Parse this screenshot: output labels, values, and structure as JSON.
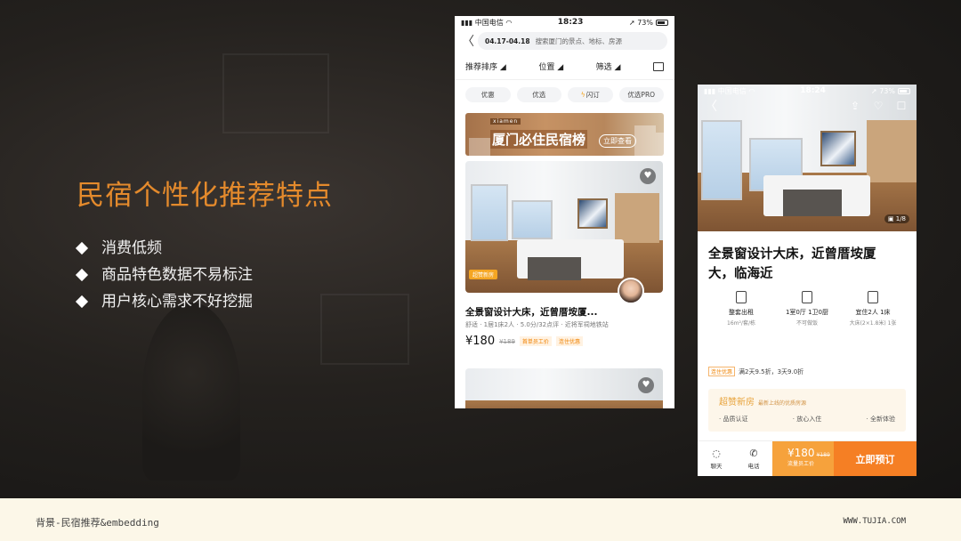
{
  "slide": {
    "title": "民宿个性化推荐特点",
    "bullets": [
      "消费低频",
      "商品特色数据不易标注",
      "用户核心需求不好挖掘"
    ],
    "footer_left": "背景-民宿推荐&embedding",
    "footer_right": "WWW.TUJIA.COM"
  },
  "colors": {
    "accent": "#e48a2c",
    "orange": "#f57f24",
    "footer_bg": "#fcf7e8"
  },
  "phone1": {
    "status": {
      "carrier": "中国电信",
      "time": "18:23",
      "battery": "73%"
    },
    "search": {
      "dates": "04.17-04.18",
      "placeholder": "搜索厦门的景点、地标、房源"
    },
    "filters": [
      "推荐排序",
      "位置",
      "筛选"
    ],
    "chips": [
      "优惠",
      "优选",
      "闪订",
      "优选PRO"
    ],
    "banner": {
      "tag": "xiamen",
      "title": "厦门必住民宿榜",
      "cta": "立即查看"
    },
    "listing": {
      "tag": "超赞新房",
      "title": "全景窗设计大床，近曾厝垵厦...",
      "meta": "舒适 · 1居1床2人 · 5.0分/32点评 · 近将军祠地铁站",
      "price": "¥180",
      "old_price": "¥189",
      "tags": [
        "首单员工价",
        "连住优惠"
      ]
    }
  },
  "phone2": {
    "status": {
      "carrier": "中国电信",
      "time": "18:24",
      "battery": "73%"
    },
    "photo_counter": "1/8",
    "title": "全景窗设计大床，近曾厝垵厦大，临海近",
    "amenities": [
      {
        "icon": "house-icon",
        "a": "整套出租",
        "b": "16m²/套/栋"
      },
      {
        "icon": "door-icon",
        "a": "1室0厅 1卫0厨",
        "b": "不可做饭"
      },
      {
        "icon": "bed-icon",
        "a": "宜住2人 1床",
        "b": "大床(2×1.8米) 1张"
      }
    ],
    "promo": {
      "tag": "连住优惠",
      "text": "满2天9.5折，3天9.0折"
    },
    "new_house": {
      "title": "超赞新房",
      "subtitle": "最新上线的优质房源",
      "features": [
        "· 品质认证",
        "· 放心入住",
        "· 全新体验"
      ]
    },
    "bottom": {
      "chat": "聊天",
      "phone": "电话",
      "price": "¥180",
      "old_price": "¥189",
      "price_note": "流量员工价",
      "book": "立即预订"
    }
  }
}
